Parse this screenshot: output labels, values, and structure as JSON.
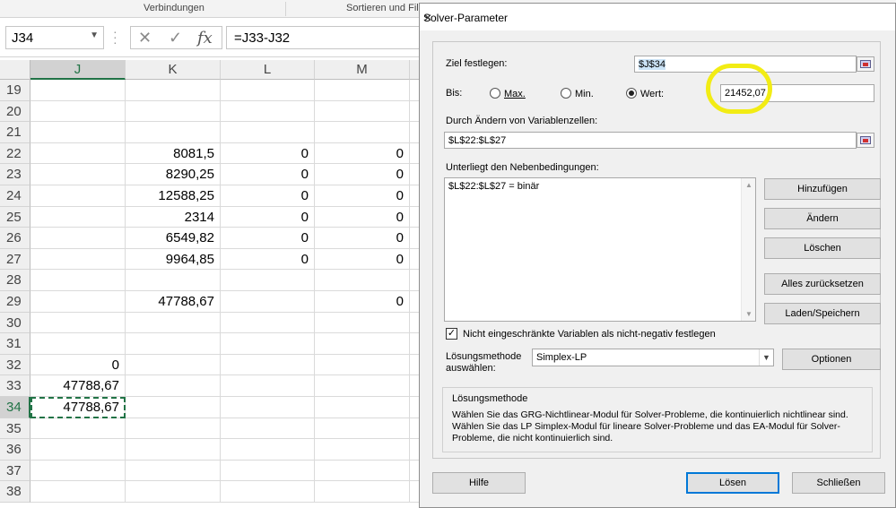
{
  "ribbon": {
    "groups": [
      "Verbindungen",
      "Sortieren und Fil"
    ]
  },
  "formula_bar": {
    "name_box": "J34",
    "cancel_glyph": "✕",
    "enter_glyph": "✓",
    "fx_glyph": "fx",
    "formula": "=J33-J32"
  },
  "columns": [
    "J",
    "K",
    "L",
    "M"
  ],
  "rows": [
    {
      "n": "19",
      "J": "",
      "K": "",
      "L": "",
      "M": ""
    },
    {
      "n": "20",
      "J": "",
      "K": "",
      "L": "",
      "M": ""
    },
    {
      "n": "21",
      "J": "",
      "K": "",
      "L": "",
      "M": ""
    },
    {
      "n": "22",
      "J": "",
      "K": "8081,5",
      "L": "0",
      "M": "0"
    },
    {
      "n": "23",
      "J": "",
      "K": "8290,25",
      "L": "0",
      "M": "0"
    },
    {
      "n": "24",
      "J": "",
      "K": "12588,25",
      "L": "0",
      "M": "0"
    },
    {
      "n": "25",
      "J": "",
      "K": "2314",
      "L": "0",
      "M": "0"
    },
    {
      "n": "26",
      "J": "",
      "K": "6549,82",
      "L": "0",
      "M": "0"
    },
    {
      "n": "27",
      "J": "",
      "K": "9964,85",
      "L": "0",
      "M": "0"
    },
    {
      "n": "28",
      "J": "",
      "K": "",
      "L": "",
      "M": ""
    },
    {
      "n": "29",
      "J": "",
      "K": "47788,67",
      "L": "",
      "M": "0"
    },
    {
      "n": "30",
      "J": "",
      "K": "",
      "L": "",
      "M": ""
    },
    {
      "n": "31",
      "J": "",
      "K": "",
      "L": "",
      "M": ""
    },
    {
      "n": "32",
      "J": "0",
      "K": "",
      "L": "",
      "M": ""
    },
    {
      "n": "33",
      "J": "47788,67",
      "K": "",
      "L": "",
      "M": ""
    },
    {
      "n": "34",
      "J": "47788,67",
      "K": "",
      "L": "",
      "M": ""
    },
    {
      "n": "35",
      "J": "",
      "K": "",
      "L": "",
      "M": ""
    },
    {
      "n": "36",
      "J": "",
      "K": "",
      "L": "",
      "M": ""
    },
    {
      "n": "37",
      "J": "",
      "K": "",
      "L": "",
      "M": ""
    },
    {
      "n": "38",
      "J": "",
      "K": "",
      "L": "",
      "M": ""
    }
  ],
  "dialog": {
    "title": "Solver-Parameter",
    "close_glyph": "✕",
    "objective_label": "Ziel festlegen:",
    "objective_value": "$J$34",
    "to_label": "Bis:",
    "radio_max": "Max.",
    "radio_min": "Min.",
    "radio_value": "Wert:",
    "selected_radio": "value",
    "target_value": "21452,07",
    "changing_label": "Durch Ändern von Variablenzellen:",
    "changing_value": "$L$22:$L$27",
    "constraints_label": "Unterliegt den Nebenbedingungen:",
    "constraints": [
      "$L$22:$L$27 = binär"
    ],
    "buttons": {
      "add": "Hinzufügen",
      "change": "Ändern",
      "delete": "Löschen",
      "reset_all": "Alles zurücksetzen",
      "load_save": "Laden/Speichern",
      "options": "Optionen",
      "help": "Hilfe",
      "solve": "Lösen",
      "close": "Schließen"
    },
    "nonneg_checked": true,
    "nonneg_label": "Nicht eingeschränkte Variablen als nicht-negativ festlegen",
    "method_label_line1": "Lösungsmethode",
    "method_label_line2": "auswählen:",
    "method_value": "Simplex-LP",
    "method_group_title": "Lösungsmethode",
    "method_description": "Wählen Sie das GRG-Nichtlinear-Modul für Solver-Probleme, die kontinuierlich nichtlinear sind. Wählen Sie das LP Simplex-Modul für lineare Solver-Probleme und das EA-Modul für Solver-Probleme, die nicht kontinuierlich sind."
  },
  "colors": {
    "excel_green": "#217346",
    "highlight_yellow": "#f2ec14",
    "default_button_border": "#0078d7"
  }
}
